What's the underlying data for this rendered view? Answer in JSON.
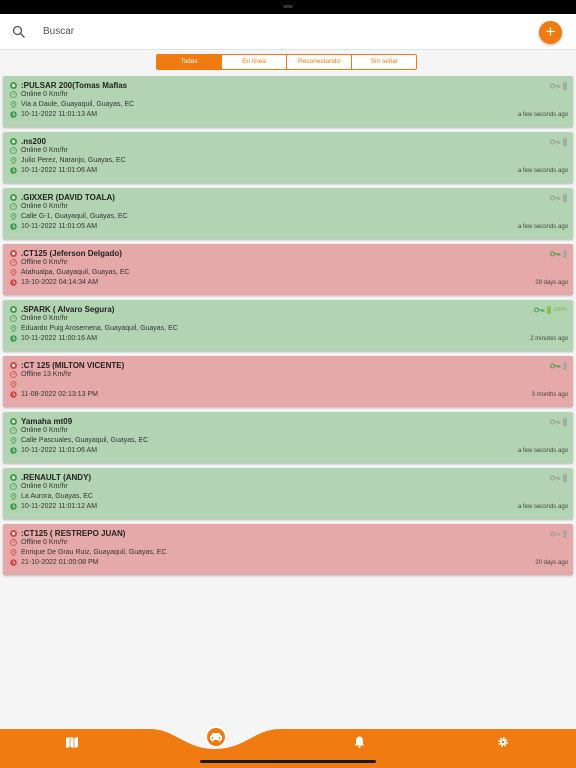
{
  "search": {
    "placeholder": "Buscar"
  },
  "fab": {
    "label": "+"
  },
  "tabs": [
    "Todas",
    "En línea",
    "Reconectando",
    "Sin señal"
  ],
  "colors": {
    "accent": "#f07c11",
    "online": "#b3d4b2",
    "offline": "#e5a9aa"
  },
  "devices": [
    {
      "name": ":PULSAR 200(Tomas Maflas",
      "status": "Online 0 Km/hr",
      "address": "Via a Daule, Guayaquil, Guayas, EC",
      "time": "10-11-2022 11:01:13 AM",
      "ago": "a few seconds ago",
      "state": "online",
      "key": "gray",
      "battery": ""
    },
    {
      "name": ".ns200",
      "status": "Online 0 Km/hr",
      "address": "Julio Perez, Naranjo, Guayas, EC",
      "time": "10-11-2022 11:01:06 AM",
      "ago": "a few seconds ago",
      "state": "online",
      "key": "gray",
      "battery": ""
    },
    {
      "name": ".GIXXER (DAVID TOALA)",
      "status": "Online 0 Km/hr",
      "address": "Calle G-1, Guayaquil, Guayas, EC",
      "time": "10-11-2022 11:01:05 AM",
      "ago": "a few seconds ago",
      "state": "online",
      "key": "gray",
      "battery": ""
    },
    {
      "name": ".CT125 (Jeferson Delgado)",
      "status": "Offline 0 Km/hr",
      "address": "Atahualpa, Guayaquil, Guayas, EC",
      "time": "13-10-2022 04:14:34 AM",
      "ago": "28 days ago",
      "state": "offline",
      "key": "green",
      "battery": ""
    },
    {
      "name": ".SPARK ( Alvaro Segura)",
      "status": "Online 0 Km/hr",
      "address": "Eduardo Puig Arosemena, Guayaquil, Guayas, EC",
      "time": "10-11-2022 11:00:16 AM",
      "ago": "2 minutes ago",
      "state": "online",
      "key": "green",
      "battery": "100%"
    },
    {
      "name": ":CT 125 (MILTON VICENTE)",
      "status": "Offline 13 Km/hr",
      "address": "",
      "time": "11-08-2022 02:13:13 PM",
      "ago": "3 months ago",
      "state": "offline",
      "key": "green",
      "battery": ""
    },
    {
      "name": "Yamaha mt09",
      "status": "Online 0 Km/hr",
      "address": "Calle Pascuales, Guayaquil, Guayas, EC",
      "time": "10-11-2022 11:01:06 AM",
      "ago": "a few seconds ago",
      "state": "online",
      "key": "gray",
      "battery": ""
    },
    {
      "name": ".RENAULT (ANDY)",
      "status": "Online 0 Km/hr",
      "address": "La Aurora, Guayas, EC",
      "time": "10-11-2022 11:01:12 AM",
      "ago": "a few seconds ago",
      "state": "online",
      "key": "gray",
      "battery": ""
    },
    {
      "name": ":CT125 ( RESTREPO JUAN)",
      "status": "Offline 0 Km/hr",
      "address": "Enrique De Grau Ruiz, Guayaquil, Guayas, EC",
      "time": "21-10-2022 01:00:08 PM",
      "ago": "20 days ago",
      "state": "offline",
      "key": "gray",
      "battery": ""
    }
  ],
  "bottom_nav": [
    "map-icon",
    "car-icon",
    "bell-icon",
    "gear-icon"
  ]
}
